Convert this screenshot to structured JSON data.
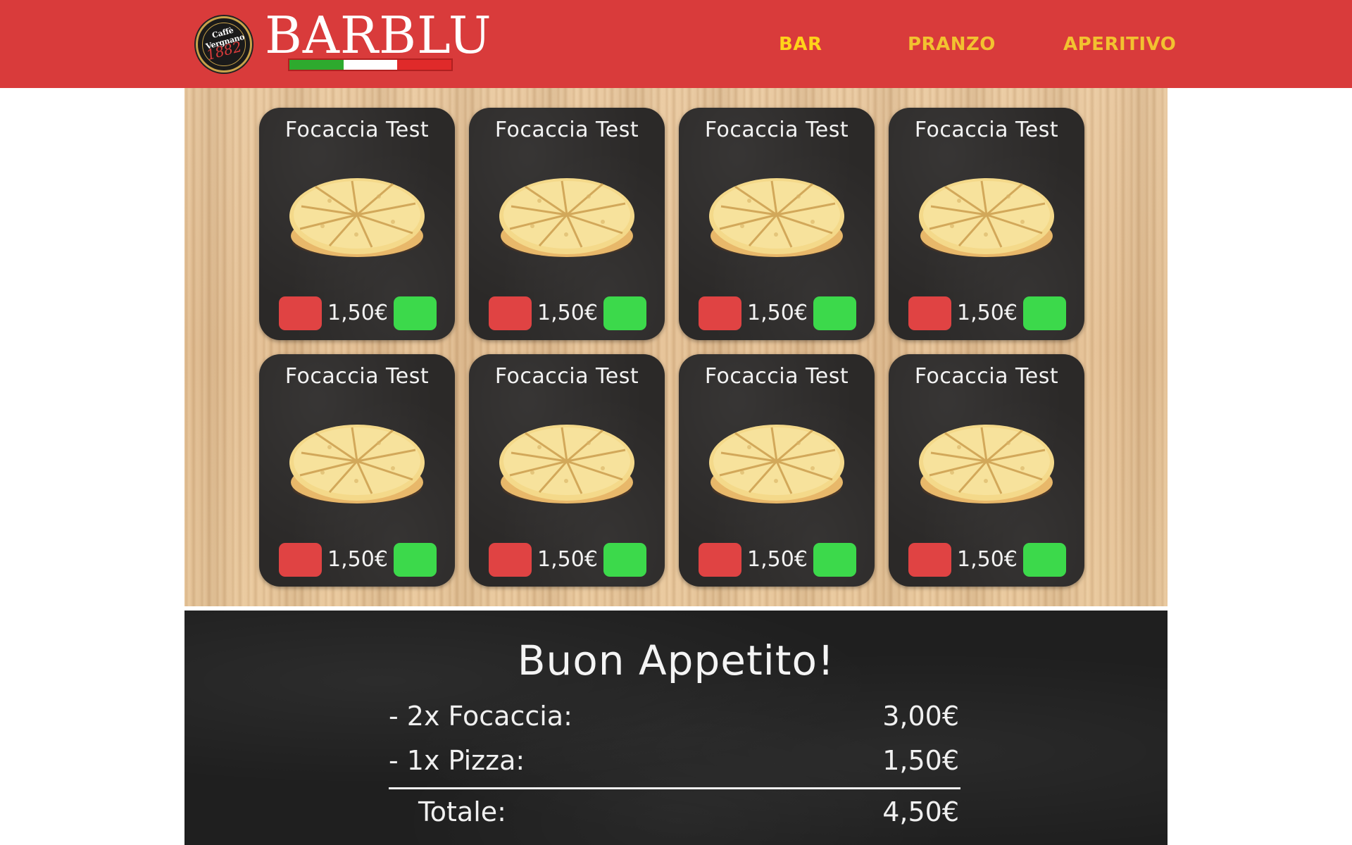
{
  "brand": {
    "logo_text_top": "Caffè Vergnano",
    "logo_text_year": "1882",
    "name": "BARBLU",
    "flag_colors": [
      "#2eaa2e",
      "#ffffff",
      "#e02a2a"
    ]
  },
  "nav": {
    "items": [
      {
        "label": "BAR",
        "active": true
      },
      {
        "label": "PRANZO",
        "active": false
      },
      {
        "label": "APERITIVO",
        "active": false
      }
    ]
  },
  "products": [
    {
      "name": "Focaccia Test",
      "price": "1,50€"
    },
    {
      "name": "Focaccia Test",
      "price": "1,50€"
    },
    {
      "name": "Focaccia Test",
      "price": "1,50€"
    },
    {
      "name": "Focaccia Test",
      "price": "1,50€"
    },
    {
      "name": "Focaccia Test",
      "price": "1,50€"
    },
    {
      "name": "Focaccia Test",
      "price": "1,50€"
    },
    {
      "name": "Focaccia Test",
      "price": "1,50€"
    },
    {
      "name": "Focaccia Test",
      "price": "1,50€"
    }
  ],
  "summary": {
    "title": "Buon Appetito!",
    "lines": [
      {
        "label": "- 2x Focaccia:",
        "amount": "3,00€"
      },
      {
        "label": "- 1x Pizza:",
        "amount": "1,50€"
      }
    ],
    "total_label": "Totale:",
    "total_amount": "4,50€"
  },
  "colors": {
    "header_bg": "#d93b3b",
    "nav_text": "#f2c230",
    "remove_button": "#e04343",
    "add_button": "#3cd94b",
    "card_bg": "#2b2928",
    "board_bg": "#1f1f1f"
  }
}
